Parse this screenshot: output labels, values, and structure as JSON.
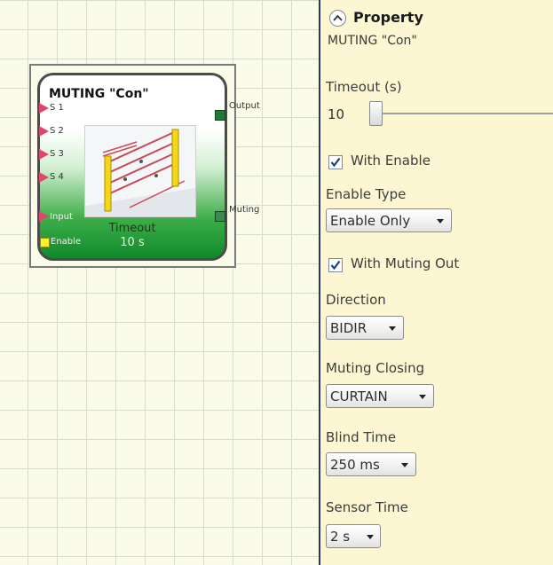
{
  "block": {
    "title": "MUTING \"Con\"",
    "inputs": [
      "S 1",
      "S 2",
      "S 3",
      "S 4",
      "Input"
    ],
    "enable_label": "Enable",
    "outputs": [
      "Output",
      "Muting"
    ],
    "timeout_label": "Timeout",
    "timeout_value": "10 s",
    "image_icon": "muting-curtain-image"
  },
  "panel": {
    "title": "Property",
    "subtitle": "MUTING \"Con\"",
    "timeout": {
      "label": "Timeout (s)",
      "value": "10"
    },
    "with_enable": {
      "label": "With Enable",
      "checked": true
    },
    "enable_type": {
      "label": "Enable Type",
      "value": "Enable Only"
    },
    "with_muting_out": {
      "label": "With Muting Out",
      "checked": true
    },
    "direction": {
      "label": "Direction",
      "value": "BIDIR"
    },
    "muting_closing": {
      "label": "Muting Closing",
      "value": "CURTAIN"
    },
    "blind_time": {
      "label": "Blind Time",
      "value": "250 ms"
    },
    "sensor_time": {
      "label": "Sensor Time",
      "value": "2 s"
    }
  },
  "colors": {
    "panel_bg": "#fcf7d2",
    "canvas_bg": "#fbfbe9",
    "divider": "#23386b",
    "block_green": "#0f8a2a",
    "input_pin": "#e0466a",
    "enable_pin": "#ffef2e",
    "output_pin": "#1f7a36"
  }
}
